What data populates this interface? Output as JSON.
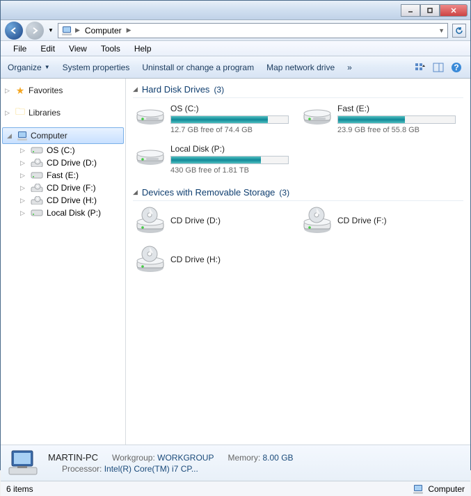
{
  "titlebar": {},
  "nav": {
    "crumb_root": "Computer"
  },
  "menu": {
    "file": "File",
    "edit": "Edit",
    "view": "View",
    "tools": "Tools",
    "help": "Help"
  },
  "toolbar": {
    "organize": "Organize",
    "sysprops": "System properties",
    "uninstall": "Uninstall or change a program",
    "mapdrive": "Map network drive",
    "chevrons": "»"
  },
  "sidebar": {
    "favorites": "Favorites",
    "libraries": "Libraries",
    "computer": "Computer",
    "computer_items": [
      {
        "label": "OS (C:)",
        "type": "hdd"
      },
      {
        "label": "CD Drive (D:)",
        "type": "cd"
      },
      {
        "label": "Fast (E:)",
        "type": "hdd"
      },
      {
        "label": "CD Drive (F:)",
        "type": "cd"
      },
      {
        "label": "CD Drive (H:)",
        "type": "cd"
      },
      {
        "label": "Local Disk (P:)",
        "type": "hdd"
      }
    ]
  },
  "sections": {
    "hdd_title": "Hard Disk Drives",
    "hdd_count": "(3)",
    "removable_title": "Devices with Removable Storage",
    "removable_count": "(3)"
  },
  "drives": {
    "hdd": [
      {
        "name": "OS (C:)",
        "free_text": "12.7 GB free of 74.4 GB",
        "fill_percent": 83
      },
      {
        "name": "Fast (E:)",
        "free_text": "23.9 GB free of 55.8 GB",
        "fill_percent": 57
      },
      {
        "name": "Local Disk (P:)",
        "free_text": "430 GB free of 1.81 TB",
        "fill_percent": 77
      }
    ],
    "removable": [
      {
        "name": "CD Drive (D:)"
      },
      {
        "name": "CD Drive (F:)"
      },
      {
        "name": "CD Drive (H:)"
      }
    ]
  },
  "details": {
    "name": "MARTIN-PC",
    "workgroup_label": "Workgroup:",
    "workgroup": "WORKGROUP",
    "memory_label": "Memory:",
    "memory": "8.00 GB",
    "processor_label": "Processor:",
    "processor": "Intel(R) Core(TM) i7 CP..."
  },
  "status": {
    "items": "6 items",
    "location": "Computer"
  }
}
